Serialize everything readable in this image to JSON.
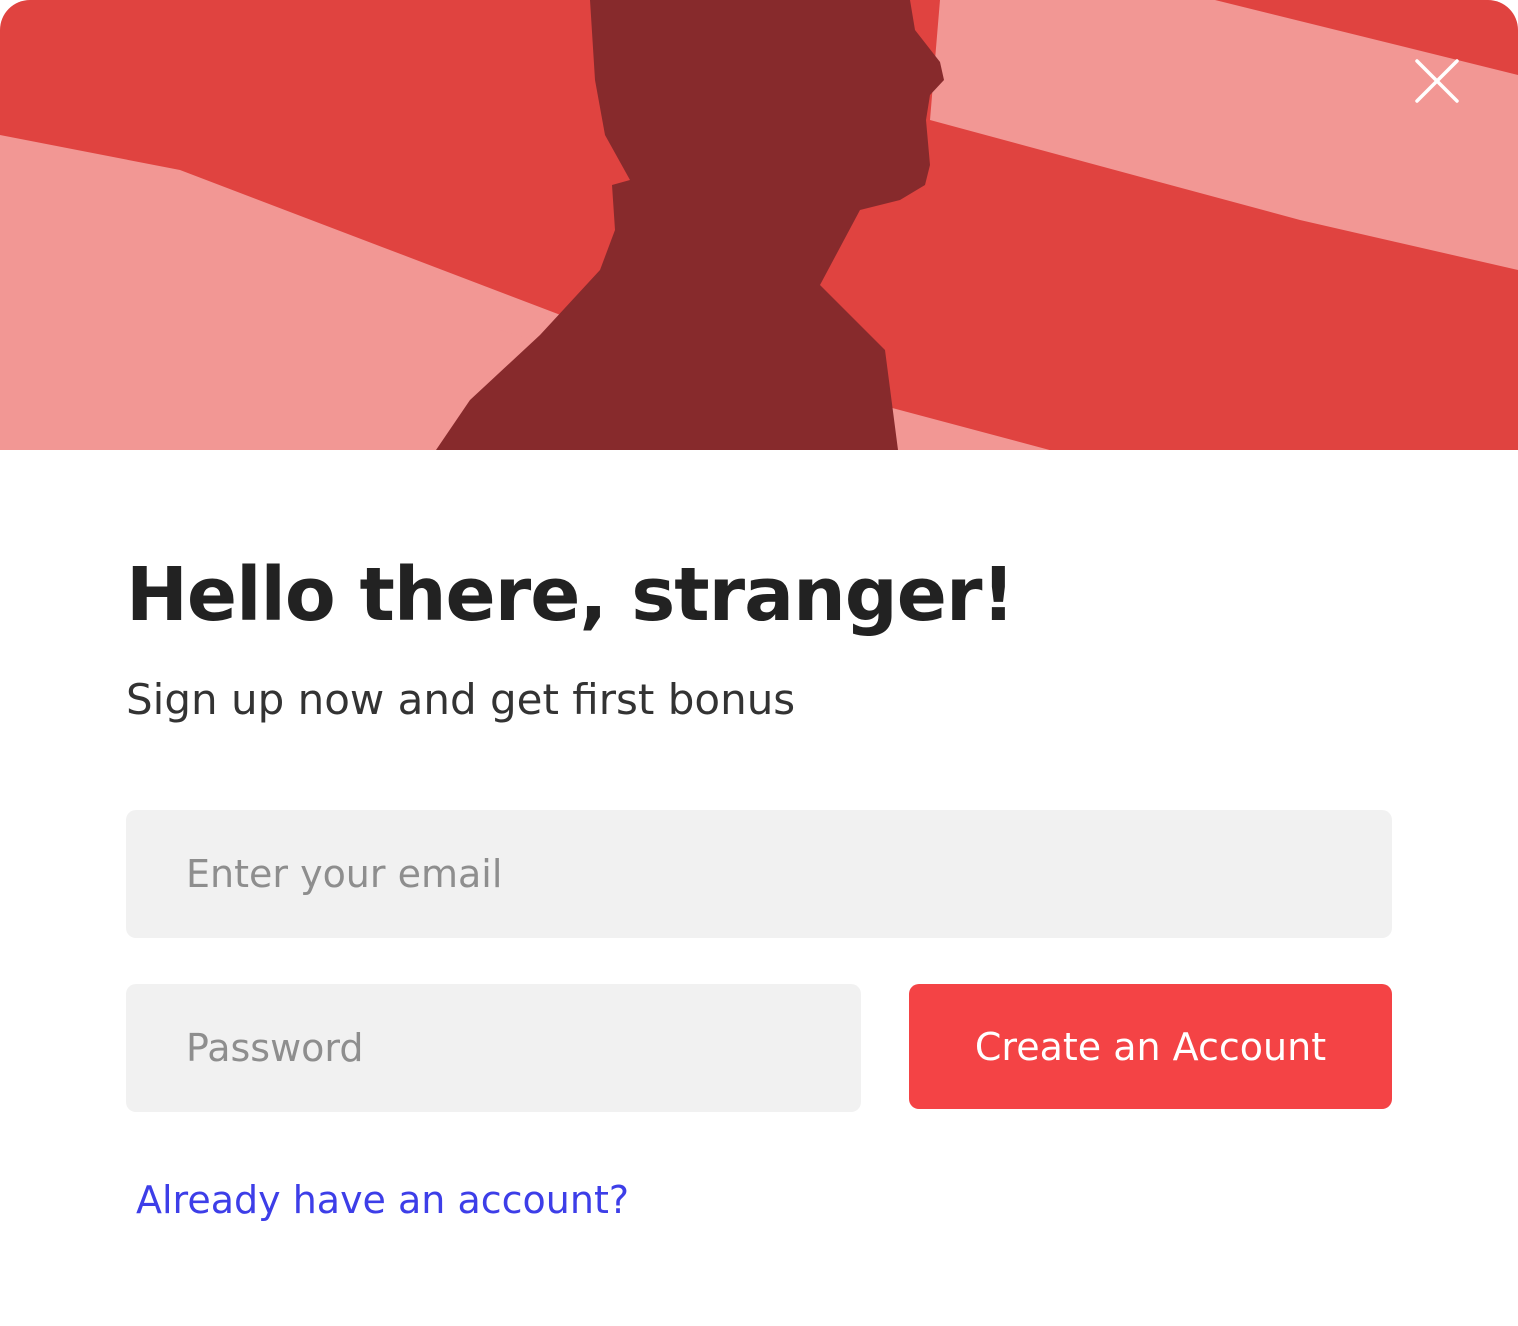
{
  "dialog": {
    "close_icon": "close-icon",
    "hero_image": "man-silhouette-red-stripes"
  },
  "content": {
    "headline": "Hello there, stranger!",
    "subline": "Sign up now and get first bonus"
  },
  "form": {
    "email_placeholder": "Enter your email",
    "email_value": "",
    "password_placeholder": "Password",
    "password_value": "",
    "submit_label": "Create an Account",
    "login_link": "Already have an account?"
  },
  "colors": {
    "accent": "#f44345",
    "link": "#3d3ee8",
    "field_bg": "#f1f1f1",
    "hero_dark": "#872a2c",
    "hero_mid": "#e04340",
    "hero_light": "#f29794"
  }
}
